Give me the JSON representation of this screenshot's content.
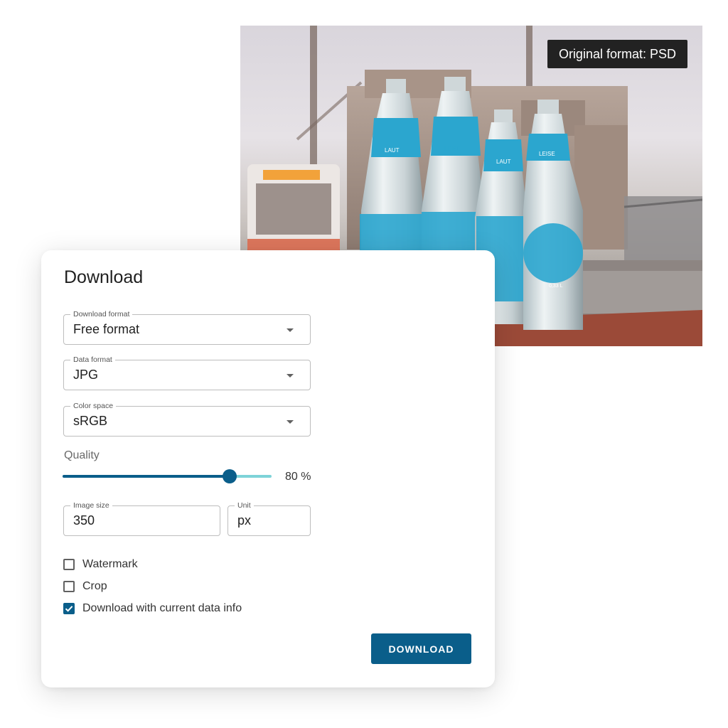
{
  "photo": {
    "badge": "Original format: PSD",
    "bottle_labels": [
      "LAUT",
      "LEISE",
      "LAUT",
      "LEISE"
    ],
    "bottle_volume": "0,33 L"
  },
  "dialog": {
    "title": "Download",
    "download_format": {
      "label": "Download format",
      "value": "Free format"
    },
    "data_format": {
      "label": "Data format",
      "value": "JPG"
    },
    "color_space": {
      "label": "Color space",
      "value": "sRGB"
    },
    "quality": {
      "label": "Quality",
      "value": 80,
      "display": "80 %"
    },
    "image_size": {
      "label": "Image size",
      "value": "350"
    },
    "unit": {
      "label": "Unit",
      "value": "px"
    },
    "options": [
      {
        "label": "Watermark",
        "checked": false
      },
      {
        "label": "Crop",
        "checked": false
      },
      {
        "label": "Download with current data info",
        "checked": true
      }
    ],
    "download_button": "DOWNLOAD"
  },
  "colors": {
    "accent": "#0a5e8a",
    "slider_rail": "#7dd3d8",
    "badge_bg": "#222222",
    "bottle_label": "#2ba6cf"
  }
}
